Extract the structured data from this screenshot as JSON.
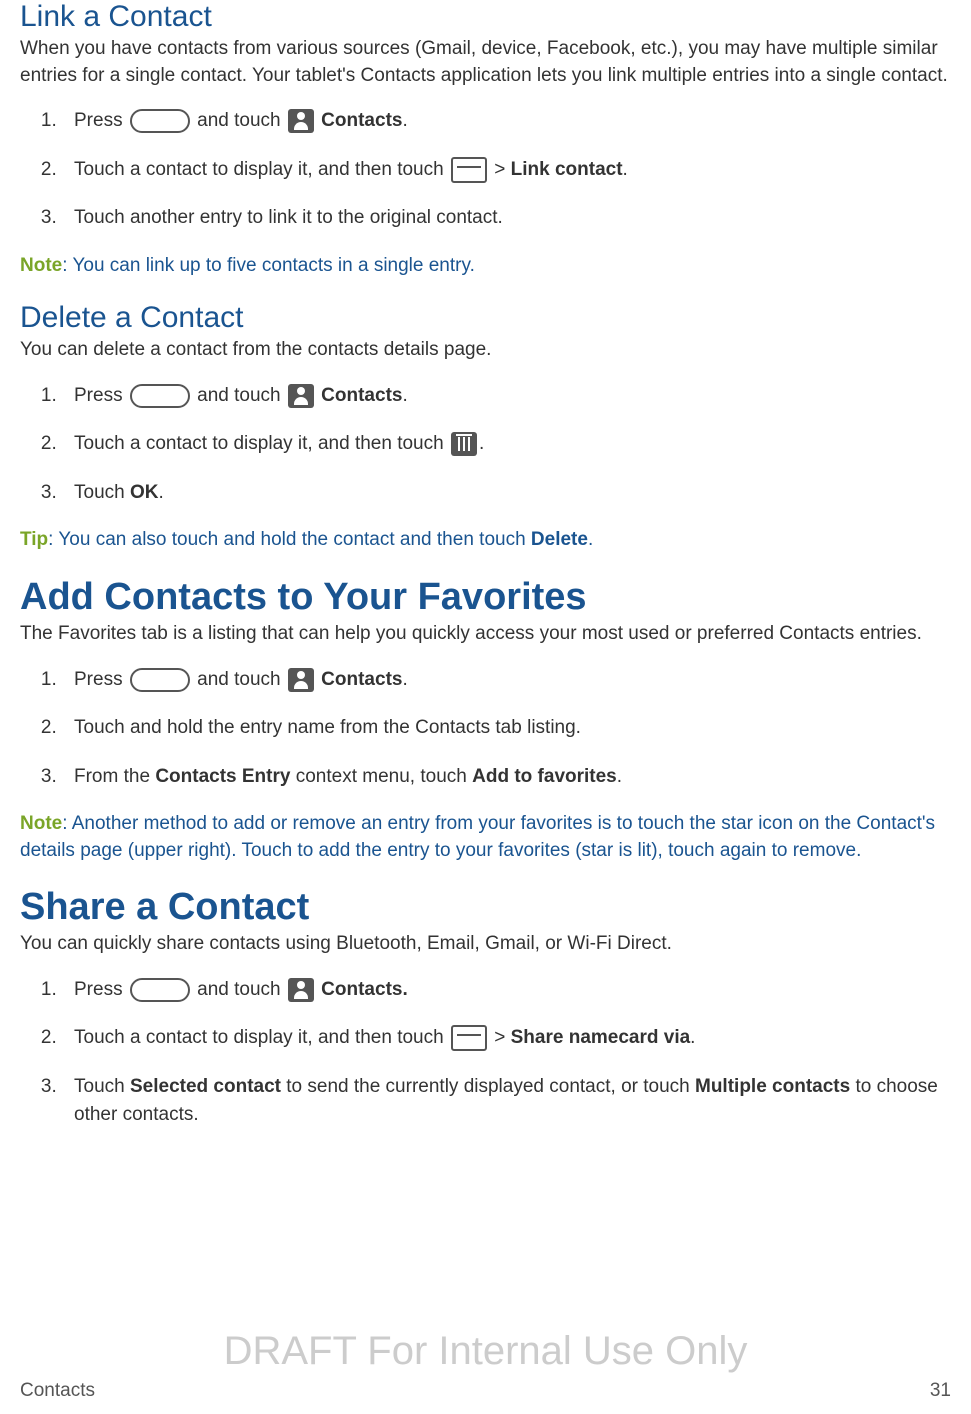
{
  "sec1": {
    "title": "Link a Contact",
    "intro": "When you have contacts from various sources (Gmail, device, Facebook, etc.), you may have multiple similar entries for a single contact. Your tablet's Contacts application lets you link multiple entries into a single contact.",
    "step1_a": "Press ",
    "step1_b": " and touch ",
    "step1_c": " Contacts",
    "step1_d": ".",
    "step2_a": "Touch a contact to display it, and then touch ",
    "step2_b": " > ",
    "step2_c": "Link contact",
    "step2_d": ".",
    "step3": "Touch another entry to link it to the original contact.",
    "note_label": "Note",
    "note_text": ": You can link up to five contacts in a single entry."
  },
  "sec2": {
    "title": "Delete a Contact",
    "intro": "You can delete a contact from the contacts details page.",
    "step1_a": "Press ",
    "step1_b": " and touch ",
    "step1_c": " Contacts",
    "step1_d": ".",
    "step2_a": "Touch a contact to display it, and then touch ",
    "step2_b": ".",
    "step3_a": "Touch ",
    "step3_b": "OK",
    "step3_c": ".",
    "tip_label": "Tip",
    "tip_a": ": You can also touch and hold the contact and then touch ",
    "tip_b": "Delete",
    "tip_c": "."
  },
  "sec3": {
    "title": "Add Contacts to Your Favorites",
    "intro": "The Favorites tab is a listing that can help you quickly access your most used or preferred Contacts entries.",
    "step1_a": "Press ",
    "step1_b": " and touch ",
    "step1_c": " Contacts",
    "step1_d": ".",
    "step2": "Touch and hold the entry name from the Contacts tab listing.",
    "step3_a": "From the ",
    "step3_b": "Contacts Entry",
    "step3_c": " context menu, touch ",
    "step3_d": "Add to favorites",
    "step3_e": ".",
    "note_label": "Note",
    "note_text": ": Another method to add or remove an entry from your favorites is to touch the star icon on the Contact's details page (upper right). Touch to add the entry to your favorites (star is lit), touch again to remove."
  },
  "sec4": {
    "title": "Share a Contact",
    "intro": "You can quickly share contacts using Bluetooth, Email, Gmail, or Wi-Fi Direct.",
    "step1_a": "Press ",
    "step1_b": " and touch ",
    "step1_c": " Contacts.",
    "step2_a": "Touch a contact to display it, and then touch ",
    "step2_b": " > ",
    "step2_c": "Share namecard via",
    "step2_d": ".",
    "step3_a": "Touch ",
    "step3_b": "Selected contact",
    "step3_c": " to send the currently displayed contact, or touch ",
    "step3_d": "Multiple contacts",
    "step3_e": " to choose other contacts."
  },
  "watermark": "DRAFT For Internal Use Only",
  "footer": {
    "left": "Contacts",
    "right": "31"
  }
}
